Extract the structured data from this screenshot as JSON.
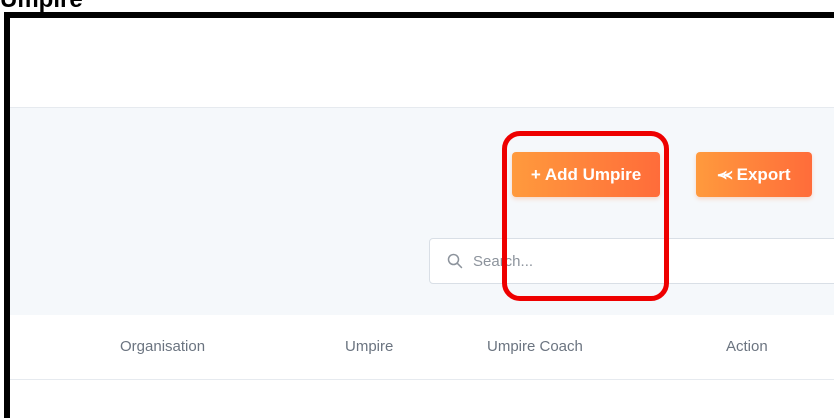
{
  "page": {
    "title": "Umpire"
  },
  "toolbar": {
    "add_label": "+ Add Umpire",
    "export_icon": "double-chevron-up-icon",
    "export_label": "Export",
    "accent_color": "#ff7a3a",
    "search_placeholder": "Search..."
  },
  "table": {
    "columns": [
      "Organisation",
      "Umpire",
      "Umpire Coach",
      "Action"
    ]
  },
  "annotation": {
    "highlight_color": "#ee0000"
  }
}
